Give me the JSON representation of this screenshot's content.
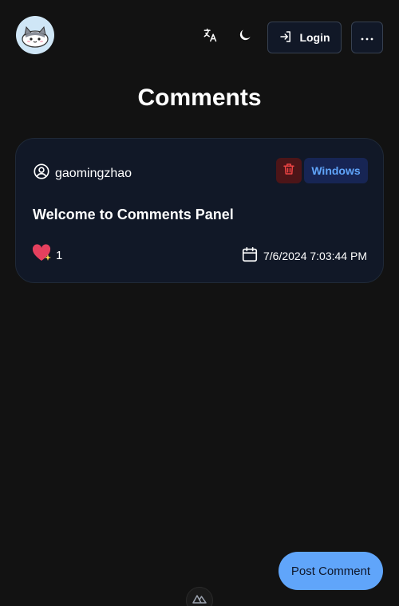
{
  "header": {
    "avatar_icon": "cat-avatar-icon",
    "translate_icon": "translate-icon",
    "theme_icon": "moon-icon",
    "login_label": "Login",
    "login_icon": "login-arrow-icon",
    "more_icon": "ellipsis-icon"
  },
  "page": {
    "title": "Comments"
  },
  "comments": [
    {
      "username": "gaomingzhao",
      "user_icon": "user-circle-icon",
      "delete_icon": "trash-icon",
      "os_badge": "Windows",
      "body": "Welcome to Comments Panel",
      "like_icon": "sparkling-heart-icon",
      "like_count": "1",
      "date_icon": "calendar-icon",
      "date": "7/6/2024 7:03:44 PM"
    }
  ],
  "actions": {
    "post_label": "Post Comment",
    "devtools_icon": "nuxt-logo-icon"
  },
  "colors": {
    "background": "#121212",
    "card": "#111827",
    "accent": "#60a5fa",
    "danger_bg": "#4c1518",
    "danger_icon": "#ef4444"
  }
}
